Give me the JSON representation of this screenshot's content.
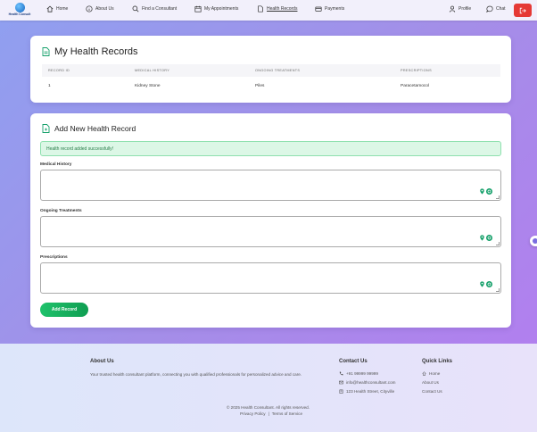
{
  "logo": {
    "text": "Health Consult"
  },
  "nav": {
    "items": [
      {
        "label": "Home",
        "icon": "home-icon"
      },
      {
        "label": "About Us",
        "icon": "info-icon"
      },
      {
        "label": "Find a Consultant",
        "icon": "search-icon"
      },
      {
        "label": "My Appointments",
        "icon": "calendar-icon"
      },
      {
        "label": "Health Records",
        "icon": "document-icon",
        "active": true
      },
      {
        "label": "Payments",
        "icon": "credit-card-icon"
      }
    ],
    "profile": "Profile",
    "chat": "Chat"
  },
  "records": {
    "title": "My Health Records",
    "columns": [
      "RECORD ID",
      "MEDICAL HISTORY",
      "ONGOING TREATMENTS",
      "PRESCRIPTIONS"
    ],
    "rows": [
      [
        "1",
        "Kidney Stone",
        "Piles",
        "Paracetamocol"
      ]
    ]
  },
  "form": {
    "title": "Add New Health Record",
    "alert": "Health record added successfully!",
    "fields": [
      {
        "label": "Medical History",
        "value": ""
      },
      {
        "label": "Ongoing Treatments",
        "value": ""
      },
      {
        "label": "Prescriptions",
        "value": ""
      }
    ],
    "submit": "Add Record"
  },
  "footer": {
    "about_title": "About Us",
    "about_text": "Your trusted health consultant platform, connecting you with qualified professionals for personalized advice and care.",
    "contact_title": "Contact Us",
    "phone": "+91 99999 99999",
    "email": "info@healthconsultant.com",
    "address": "123 Health Street, Cityville",
    "links_title": "Quick Links",
    "links": [
      "Home",
      "About Us",
      "Contact Us"
    ],
    "copyright": "© 2025 Health Consultant. All rights reserved.",
    "privacy": "Privacy Policy",
    "separator": "|",
    "terms": "Terms of Service"
  },
  "colors": {
    "accent": "#15a06a",
    "logout": "#e53935",
    "alert_bg": "#dcf7e6"
  }
}
